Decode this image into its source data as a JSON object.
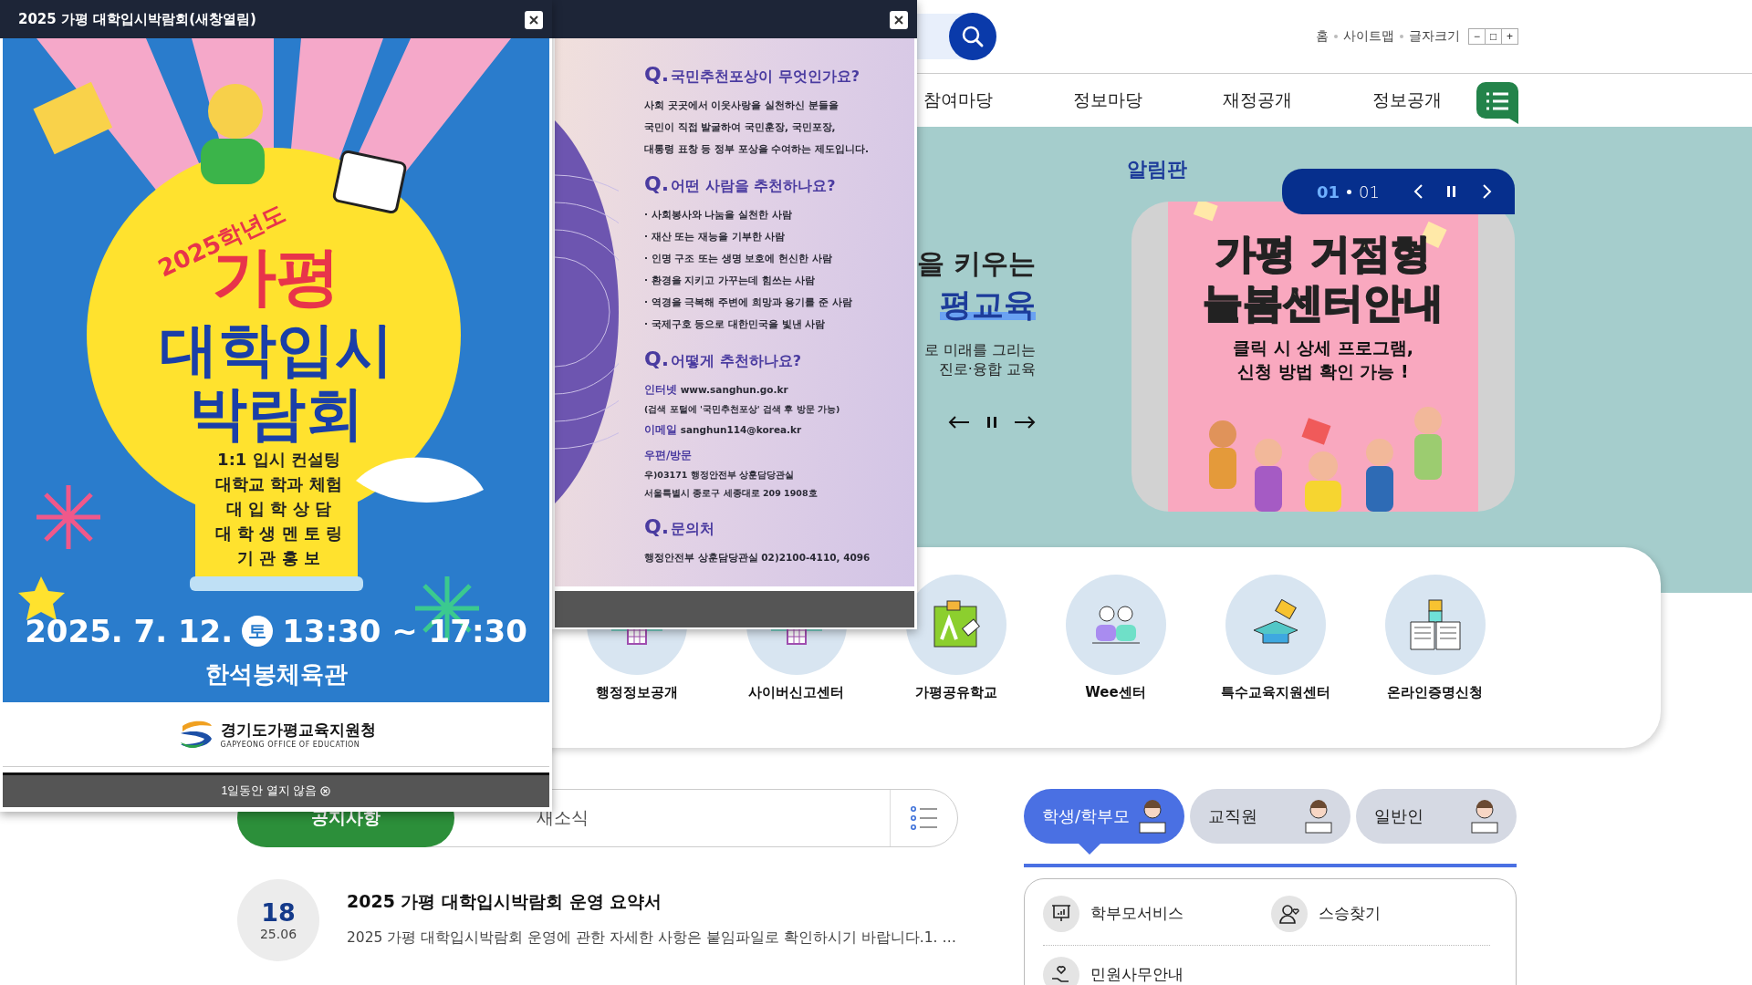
{
  "header": {
    "utility_links": [
      "홈",
      "사이트맵",
      "글자크기"
    ],
    "font_size_buttons": [
      "−",
      "□",
      "+"
    ]
  },
  "nav": {
    "items": [
      "참여마당",
      "정보마당",
      "재정공개",
      "정보공개"
    ]
  },
  "hero": {
    "lines": [
      {
        "kind": "plain",
        "text": "을 키우는"
      },
      {
        "kind": "accent",
        "text": "평교육"
      },
      {
        "kind": "small",
        "text": "로 미래를 그리는"
      },
      {
        "kind": "small",
        "text": "진로·융합 교육"
      }
    ]
  },
  "notice_board": {
    "title": "알림판",
    "current": "01",
    "total": "01",
    "banner": {
      "headline_1": "가평 거점형",
      "headline_2": "늘봄센터안내",
      "caption_1": "클릭 시 상세 프로그램,",
      "caption_2": "신청 방법 확인 가능 !"
    }
  },
  "quick_links": [
    {
      "kind": "grid",
      "label": "행정정보공개"
    },
    {
      "kind": "grid",
      "label": "사이버신고센터"
    },
    {
      "kind": "board",
      "label": "가평공유학교"
    },
    {
      "kind": "people",
      "label": "Wee센터"
    },
    {
      "kind": "cap",
      "label": "특수교육지원센터"
    },
    {
      "kind": "book",
      "label": "온라인증명신청"
    }
  ],
  "board": {
    "tabs": [
      {
        "label": "공지사항",
        "selected": true
      },
      {
        "label": "새소식",
        "selected": false
      }
    ],
    "post": {
      "day": "18",
      "date": "25.06",
      "title": "2025 가평 대학입시박람회 운영 요약서",
      "summary": "2025 가평 대학입시박람회 운영에 관한 자세한 사항은 붙임파일로 확인하시기 바랍니다.1. …"
    }
  },
  "role_tabs": [
    {
      "label": "학생/학부모",
      "selected": true
    },
    {
      "label": "교직원",
      "selected": false
    },
    {
      "label": "일반인",
      "selected": false
    }
  ],
  "services": [
    {
      "kind": "screen",
      "label": "학부모서비스"
    },
    {
      "kind": "person",
      "label": "스승찾기"
    },
    {
      "kind": "hands",
      "label": "민원사무안내"
    }
  ],
  "popup_1": {
    "title": "2025 가평 대학입시박람회(새창열림)",
    "poster": {
      "year_tag": "2025학년도",
      "title_lines": [
        "가평",
        "대학입시",
        "박람회"
      ],
      "items": [
        "1:1 입시 컨설팅",
        "대학교 학과 체험",
        "대 입 학 상 담",
        "대 학 생 멘 토 링",
        "기 관 홍 보"
      ],
      "date_1": "2025. 7. 12.",
      "weekday": "토",
      "time": "13:30 ~ 17:30",
      "venue": "한석봉체육관"
    },
    "logo": {
      "name": "경기도가평교육지원청",
      "english": "GAPYEONG OFFICE OF EDUCATION"
    },
    "dismiss_label": "1일동안 열지 않음"
  },
  "popup_2": {
    "sections": [
      {
        "marker": "Q.",
        "heading": "국민추천포상이 무엇인가요?",
        "lines": [
          {
            "kind": "plain",
            "text": "사회 곳곳에서 이웃사랑을 실천하신 분들을"
          },
          {
            "kind": "plain",
            "text": "국민이 직접 발굴하여 국민훈장, 국민포장,"
          },
          {
            "kind": "plain",
            "text": "대통령 표창 등 정부 포상을 수여하는 제도입니다."
          }
        ]
      },
      {
        "marker": "Q.",
        "heading": "어떤 사람을 추천하나요?",
        "lines": [
          {
            "kind": "plain",
            "text": "· 사회봉사와 나눔을 실천한 사람"
          },
          {
            "kind": "plain",
            "text": "· 재산 또는 재능을 기부한 사람"
          },
          {
            "kind": "plain",
            "text": "· 인명 구조 또는 생명 보호에 헌신한 사람"
          },
          {
            "kind": "plain",
            "text": "· 환경을 지키고 가꾸는데 힘쓰는 사람"
          },
          {
            "kind": "plain",
            "text": "· 역경을 극복해 주변에 희망과 용기를 준 사람"
          },
          {
            "kind": "plain",
            "text": "· 국제구호 등으로 대한민국을 빛낸 사람"
          }
        ]
      },
      {
        "marker": "Q.",
        "heading": "어떻게 추천하나요?",
        "lines": [
          {
            "kind": "labeled",
            "label": "인터넷",
            "text": "www.sanghun.go.kr"
          },
          {
            "kind": "note",
            "text": "(검색 포털에 '국민추천포상' 검색 후 방문 가능)"
          },
          {
            "kind": "labeled",
            "label": "이메일",
            "text": "sanghun114@korea.kr"
          },
          {
            "kind": "label",
            "text": "우편/방문"
          },
          {
            "kind": "note",
            "text": "우)03171 행정안전부 상훈담당관실"
          },
          {
            "kind": "note",
            "text": "서울특별시 종로구 세종대로 209 1908호"
          }
        ]
      },
      {
        "marker": "Q.",
        "heading": "문의처",
        "lines": [
          {
            "kind": "plain",
            "text": "행정안전부 상훈담당관실  02)2100-4110, 4096"
          }
        ]
      }
    ]
  }
}
